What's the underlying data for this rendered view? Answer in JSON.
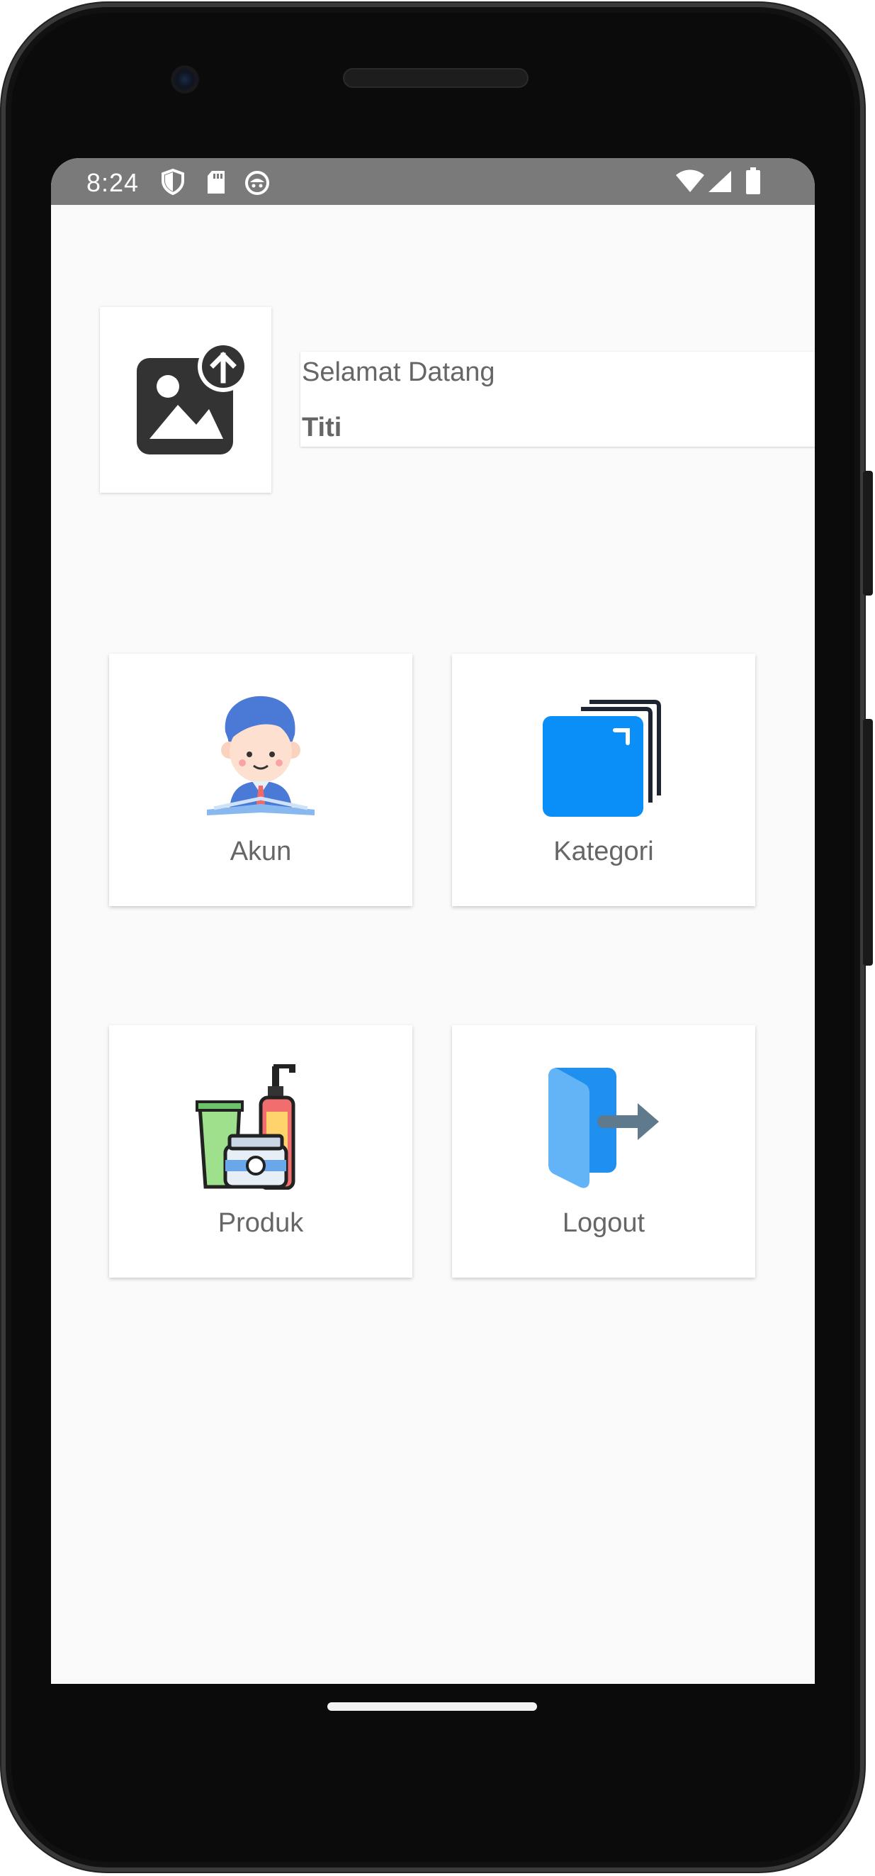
{
  "status_bar": {
    "time": "8:24",
    "left_icons": [
      "shield-icon",
      "sd-card-icon",
      "cat-face-icon"
    ],
    "right_icons": [
      "wifi-icon",
      "signal-icon",
      "battery-icon"
    ],
    "background": "#7a7a7a"
  },
  "profile": {
    "photo_icon": "image-upload-icon",
    "greeting": "Selamat Datang",
    "user_name": "Titi"
  },
  "menu": [
    {
      "label": "Akun",
      "icon": "user-account-icon"
    },
    {
      "label": "Kategori",
      "icon": "category-stack-icon",
      "color": "#0a8ef7"
    },
    {
      "label": "Produk",
      "icon": "products-icon"
    },
    {
      "label": "Logout",
      "icon": "logout-door-icon",
      "color": "#5aaef4"
    }
  ]
}
